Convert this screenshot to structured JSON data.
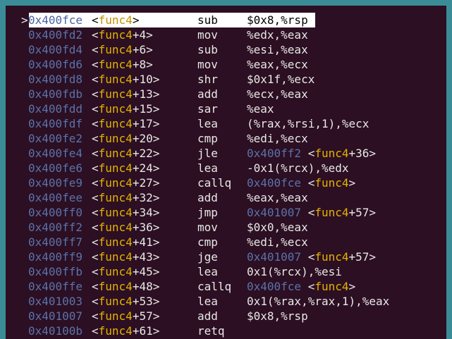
{
  "colors": {
    "background": "#2c0f22",
    "border": "#3a8c96",
    "address": "#5a73ad",
    "function_name": "#e3b400",
    "text": "#e8e8e8",
    "highlight": "#ffffff"
  },
  "current_marker": ">",
  "rows": [
    {
      "addr": "0x400fce",
      "func": "func4",
      "offset": "",
      "mnemonic": "sub",
      "operands": "$0x8,%rsp",
      "target_addr": "",
      "target_func": "",
      "target_offset": "",
      "current": true
    },
    {
      "addr": "0x400fd2",
      "func": "func4",
      "offset": "+4",
      "mnemonic": "mov",
      "operands": "%edx,%eax",
      "target_addr": "",
      "target_func": "",
      "target_offset": ""
    },
    {
      "addr": "0x400fd4",
      "func": "func4",
      "offset": "+6",
      "mnemonic": "sub",
      "operands": "%esi,%eax",
      "target_addr": "",
      "target_func": "",
      "target_offset": ""
    },
    {
      "addr": "0x400fd6",
      "func": "func4",
      "offset": "+8",
      "mnemonic": "mov",
      "operands": "%eax,%ecx",
      "target_addr": "",
      "target_func": "",
      "target_offset": ""
    },
    {
      "addr": "0x400fd8",
      "func": "func4",
      "offset": "+10",
      "mnemonic": "shr",
      "operands": "$0x1f,%ecx",
      "target_addr": "",
      "target_func": "",
      "target_offset": ""
    },
    {
      "addr": "0x400fdb",
      "func": "func4",
      "offset": "+13",
      "mnemonic": "add",
      "operands": "%ecx,%eax",
      "target_addr": "",
      "target_func": "",
      "target_offset": ""
    },
    {
      "addr": "0x400fdd",
      "func": "func4",
      "offset": "+15",
      "mnemonic": "sar",
      "operands": "%eax",
      "target_addr": "",
      "target_func": "",
      "target_offset": ""
    },
    {
      "addr": "0x400fdf",
      "func": "func4",
      "offset": "+17",
      "mnemonic": "lea",
      "operands": "(%rax,%rsi,1),%ecx",
      "target_addr": "",
      "target_func": "",
      "target_offset": ""
    },
    {
      "addr": "0x400fe2",
      "func": "func4",
      "offset": "+20",
      "mnemonic": "cmp",
      "operands": "%edi,%ecx",
      "target_addr": "",
      "target_func": "",
      "target_offset": ""
    },
    {
      "addr": "0x400fe4",
      "func": "func4",
      "offset": "+22",
      "mnemonic": "jle",
      "operands": "",
      "target_addr": "0x400ff2",
      "target_func": "func4",
      "target_offset": "+36"
    },
    {
      "addr": "0x400fe6",
      "func": "func4",
      "offset": "+24",
      "mnemonic": "lea",
      "operands": "-0x1(%rcx),%edx",
      "target_addr": "",
      "target_func": "",
      "target_offset": ""
    },
    {
      "addr": "0x400fe9",
      "func": "func4",
      "offset": "+27",
      "mnemonic": "callq",
      "operands": "",
      "target_addr": "0x400fce",
      "target_func": "func4",
      "target_offset": ""
    },
    {
      "addr": "0x400fee",
      "func": "func4",
      "offset": "+32",
      "mnemonic": "add",
      "operands": "%eax,%eax",
      "target_addr": "",
      "target_func": "",
      "target_offset": ""
    },
    {
      "addr": "0x400ff0",
      "func": "func4",
      "offset": "+34",
      "mnemonic": "jmp",
      "operands": "",
      "target_addr": "0x401007",
      "target_func": "func4",
      "target_offset": "+57"
    },
    {
      "addr": "0x400ff2",
      "func": "func4",
      "offset": "+36",
      "mnemonic": "mov",
      "operands": "$0x0,%eax",
      "target_addr": "",
      "target_func": "",
      "target_offset": ""
    },
    {
      "addr": "0x400ff7",
      "func": "func4",
      "offset": "+41",
      "mnemonic": "cmp",
      "operands": "%edi,%ecx",
      "target_addr": "",
      "target_func": "",
      "target_offset": ""
    },
    {
      "addr": "0x400ff9",
      "func": "func4",
      "offset": "+43",
      "mnemonic": "jge",
      "operands": "",
      "target_addr": "0x401007",
      "target_func": "func4",
      "target_offset": "+57"
    },
    {
      "addr": "0x400ffb",
      "func": "func4",
      "offset": "+45",
      "mnemonic": "lea",
      "operands": "0x1(%rcx),%esi",
      "target_addr": "",
      "target_func": "",
      "target_offset": ""
    },
    {
      "addr": "0x400ffe",
      "func": "func4",
      "offset": "+48",
      "mnemonic": "callq",
      "operands": "",
      "target_addr": "0x400fce",
      "target_func": "func4",
      "target_offset": ""
    },
    {
      "addr": "0x401003",
      "func": "func4",
      "offset": "+53",
      "mnemonic": "lea",
      "operands": "0x1(%rax,%rax,1),%eax",
      "target_addr": "",
      "target_func": "",
      "target_offset": ""
    },
    {
      "addr": "0x401007",
      "func": "func4",
      "offset": "+57",
      "mnemonic": "add",
      "operands": "$0x8,%rsp",
      "target_addr": "",
      "target_func": "",
      "target_offset": ""
    },
    {
      "addr": "0x40100b",
      "func": "func4",
      "offset": "+61",
      "mnemonic": "retq",
      "operands": "",
      "target_addr": "",
      "target_func": "",
      "target_offset": ""
    }
  ]
}
